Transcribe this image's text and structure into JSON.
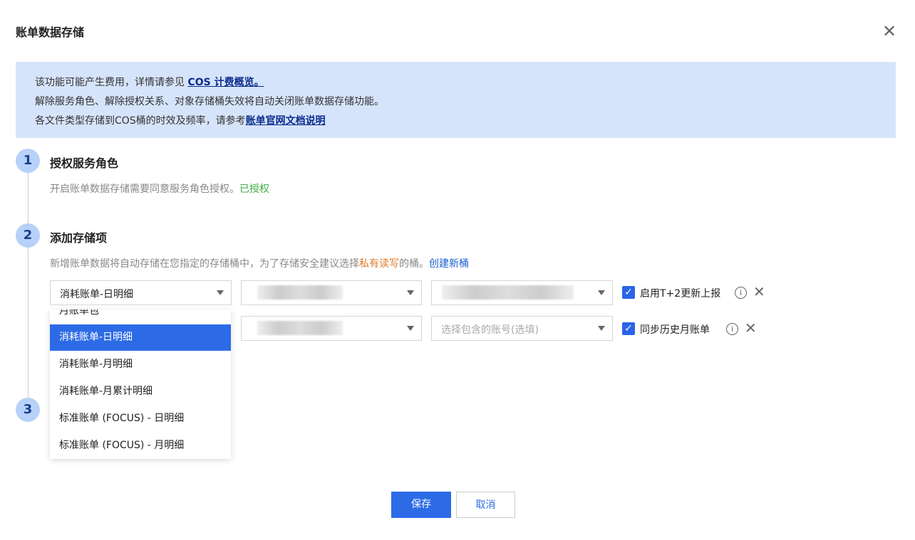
{
  "dialog": {
    "title": "账单数据存储",
    "close_icon": "close-icon"
  },
  "banner": {
    "line1_text": "该功能可能产生费用，详情请参见 ",
    "line1_link": "COS 计费概览。",
    "line2_text": "解除服务角色、解除授权关系、对象存储桶失效将自动关闭账单数据存储功能。",
    "line3_text": "各文件类型存储到COS桶的时效及频率，请参考",
    "line3_link": "账单官网文档说明"
  },
  "steps": [
    {
      "number": "1",
      "title": "授权服务角色",
      "desc": "开启账单数据存储需要同意服务角色授权。",
      "status": "已授权"
    },
    {
      "number": "2",
      "title": "添加存储项",
      "desc_pre": "新增账单数据将自动存储在您指定的存储桶中，为了存储安全建议选择",
      "desc_highlight": "私有读写",
      "desc_post": "的桶。",
      "link": "创建新桶"
    },
    {
      "number": "3"
    }
  ],
  "rows": [
    {
      "type_value": "消耗账单-日明细",
      "option_label": "启用T+2更新上报",
      "checked": true
    },
    {
      "account_placeholder": "选择包含的账号(选填)",
      "option_label": "同步历史月账单",
      "checked": true
    }
  ],
  "dropdown": {
    "partial_item": "月账单包",
    "items": [
      "消耗账单-日明细",
      "消耗账单-月明细",
      "消耗账单-月累计明细",
      "标准账单 (FOCUS) - 日明细",
      "标准账单 (FOCUS) - 月明细"
    ],
    "selected_index": 0
  },
  "footer": {
    "save": "保存",
    "cancel": "取消"
  },
  "colors": {
    "primary": "#2d6be6",
    "banner": "#d6e4fb",
    "success": "#3fae49",
    "warning": "#e07a26"
  }
}
